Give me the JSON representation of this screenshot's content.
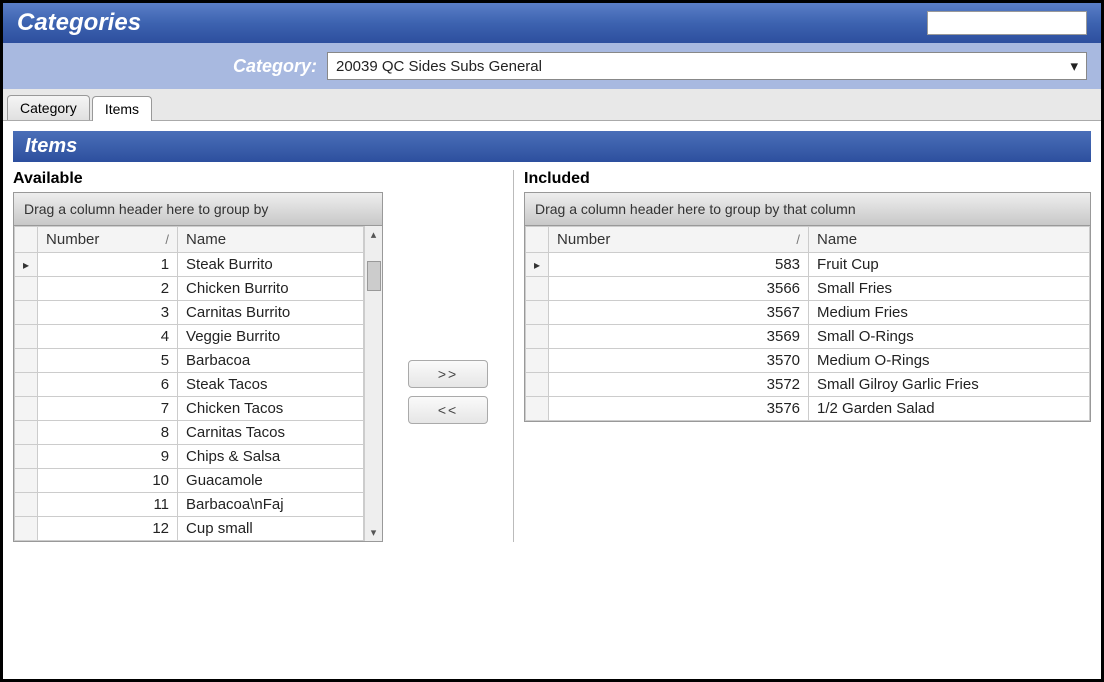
{
  "title": "Categories",
  "category_label": "Category:",
  "category_selected": "20039 QC Sides Subs General",
  "tabs": {
    "category": "Category",
    "items": "Items"
  },
  "section_header": "Items",
  "available": {
    "title": "Available",
    "group_hint": "Drag a column header here to group by",
    "col_number": "Number",
    "col_name": "Name",
    "rows": [
      {
        "num": "1",
        "name": "Steak Burrito"
      },
      {
        "num": "2",
        "name": "Chicken Burrito"
      },
      {
        "num": "3",
        "name": "Carnitas Burrito"
      },
      {
        "num": "4",
        "name": "Veggie Burrito"
      },
      {
        "num": "5",
        "name": "Barbacoa"
      },
      {
        "num": "6",
        "name": "Steak Tacos"
      },
      {
        "num": "7",
        "name": "Chicken Tacos"
      },
      {
        "num": "8",
        "name": "Carnitas Tacos"
      },
      {
        "num": "9",
        "name": "Chips & Salsa"
      },
      {
        "num": "10",
        "name": "Guacamole"
      },
      {
        "num": "11",
        "name": "Barbacoa\\nFaj"
      },
      {
        "num": "12",
        "name": "Cup small"
      }
    ]
  },
  "included": {
    "title": "Included",
    "group_hint": "Drag a column header here to group by that column",
    "col_number": "Number",
    "col_name": "Name",
    "rows": [
      {
        "num": "583",
        "name": "Fruit Cup"
      },
      {
        "num": "3566",
        "name": "Small Fries"
      },
      {
        "num": "3567",
        "name": "Medium Fries"
      },
      {
        "num": "3569",
        "name": "Small O-Rings"
      },
      {
        "num": "3570",
        "name": "Medium O-Rings"
      },
      {
        "num": "3572",
        "name": "Small Gilroy Garlic Fries"
      },
      {
        "num": "3576",
        "name": "1/2 Garden Salad"
      }
    ]
  },
  "buttons": {
    "add": ">>",
    "remove": "<<"
  }
}
